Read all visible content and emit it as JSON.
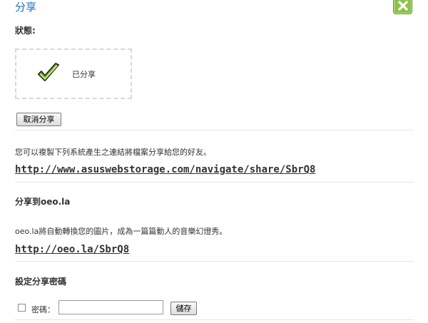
{
  "dialog": {
    "title": "分享",
    "close_icon": "close-x-icon",
    "accent_color": "#1f6fb5",
    "close_color": "#8bc34a"
  },
  "status": {
    "label": "狀態:",
    "icon": "checkmark-icon",
    "text": "已分享"
  },
  "cancel_share_label": "取消分享",
  "share_link": {
    "description": "您可以複製下列系統產生之連結將檔案分享給您的好友。",
    "url": "http://www.asuswebstorage.com/navigate/share/SbrQ8"
  },
  "oeo": {
    "title": "分享到oeo.la",
    "description": "oeo.la將自動轉換您的圖片，成為一篇篇動人的音樂幻燈秀。",
    "url": "http://oeo.la/SbrQ8"
  },
  "password": {
    "section_title": "設定分享密碼",
    "label": "密碼：",
    "value": "",
    "save_label": "儲存"
  }
}
